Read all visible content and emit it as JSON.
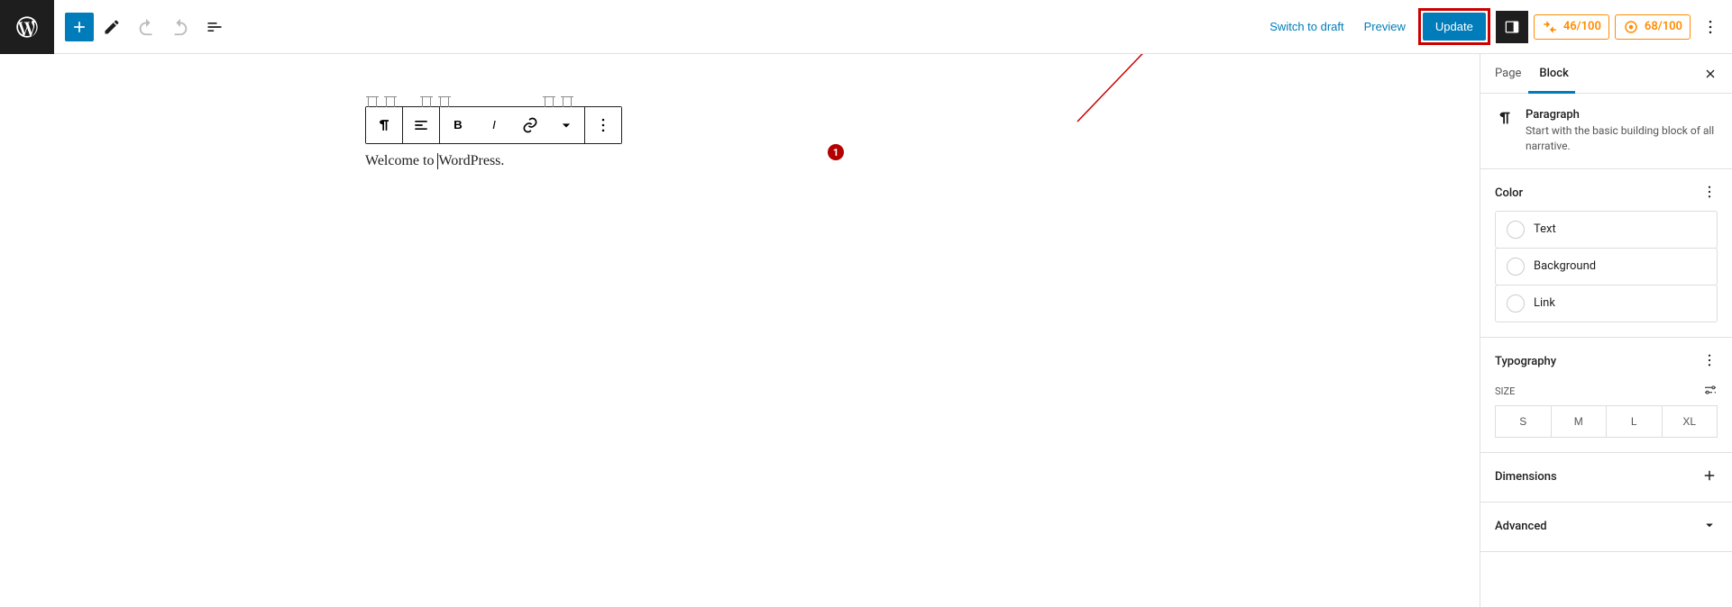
{
  "topbar": {
    "switch_draft": "Switch to draft",
    "preview": "Preview",
    "update": "Update",
    "seo_score_1": "46/100",
    "seo_score_2": "68/100"
  },
  "sidebar": {
    "tab_page": "Page",
    "tab_block": "Block",
    "block": {
      "title": "Paragraph",
      "desc": "Start with the basic building block of all narrative."
    },
    "color": {
      "heading": "Color",
      "text": "Text",
      "background": "Background",
      "link": "Link"
    },
    "typography": {
      "heading": "Typography",
      "size_label": "SIZE",
      "sizes": [
        "S",
        "M",
        "L",
        "XL"
      ]
    },
    "dimensions": "Dimensions",
    "advanced": "Advanced"
  },
  "editor": {
    "paragraph_before": "Welcome to ",
    "paragraph_after": "WordPress."
  },
  "annotation": {
    "badge": "1"
  }
}
